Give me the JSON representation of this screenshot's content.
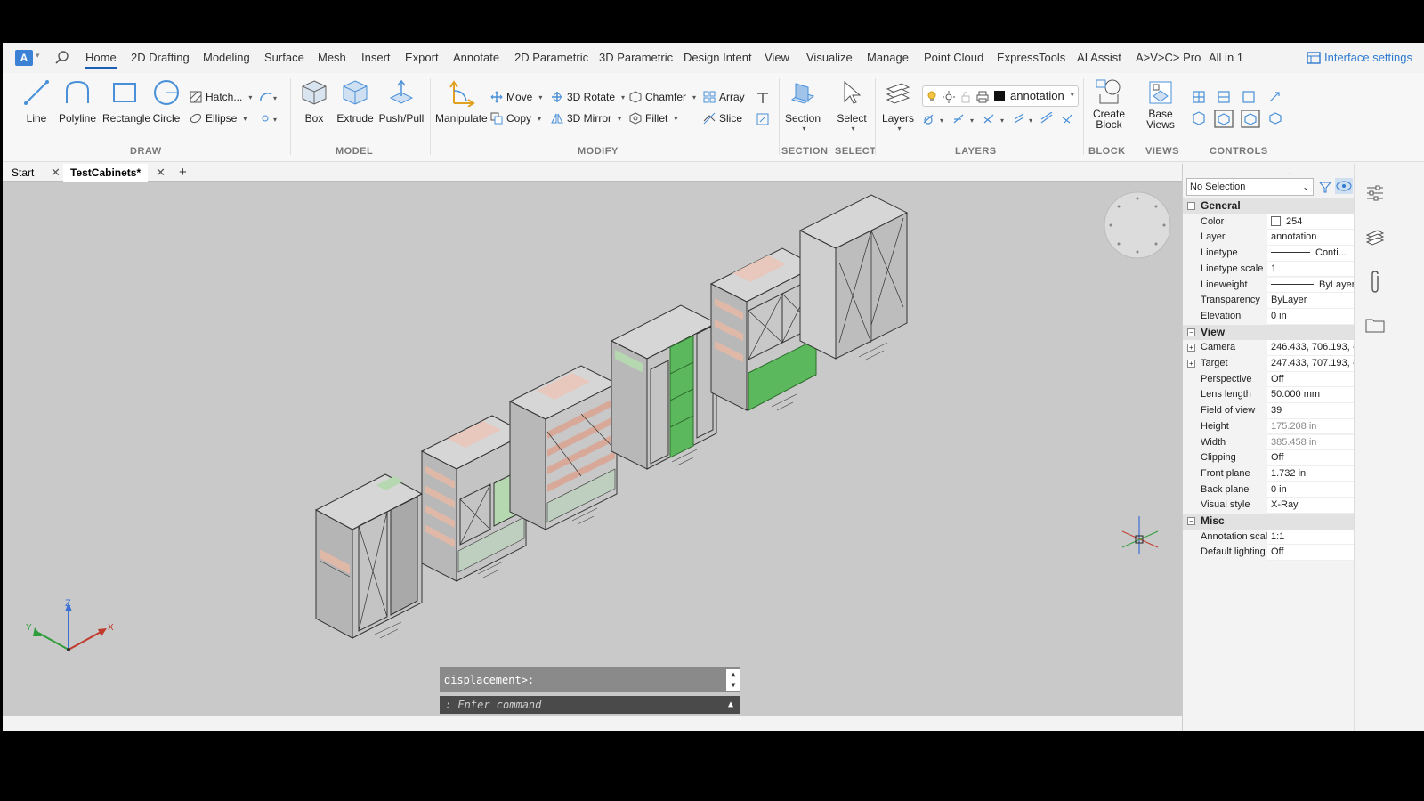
{
  "menu": {
    "tabs": [
      "Home",
      "2D Drafting",
      "Modeling",
      "Surface",
      "Mesh",
      "Insert",
      "Export",
      "Annotate",
      "2D Parametric",
      "3D Parametric",
      "Design Intent",
      "View",
      "Visualize",
      "Manage",
      "Point Cloud",
      "ExpressTools",
      "AI Assist",
      "A>V>C> Pro",
      "All in 1"
    ],
    "active": "Home",
    "interface_settings": "Interface settings"
  },
  "ribbon": {
    "draw": {
      "line": "Line",
      "polyline": "Polyline",
      "rectangle": "Rectangle",
      "circle": "Circle",
      "hatch": "Hatch...",
      "ellipse": "Ellipse",
      "group": "DRAW"
    },
    "model": {
      "box": "Box",
      "extrude": "Extrude",
      "pushpull": "Push/Pull",
      "group": "MODEL"
    },
    "modify": {
      "manipulate": "Manipulate",
      "move": "Move",
      "copy": "Copy",
      "rotate3d": "3D Rotate",
      "mirror3d": "3D Mirror",
      "chamfer": "Chamfer",
      "fillet": "Fillet",
      "array": "Array",
      "slice": "Slice",
      "group": "MODIFY"
    },
    "section": {
      "label": "Section",
      "group": "SECTION"
    },
    "select": {
      "label": "Select",
      "group": "SELECT"
    },
    "layers": {
      "label": "Layers",
      "current": "annotation",
      "group": "LAYERS"
    },
    "block": {
      "create": "Create Block",
      "group": "BLOCK"
    },
    "views": {
      "base": "Base Views",
      "group": "VIEWS"
    },
    "controls": {
      "group": "CONTROLS"
    }
  },
  "doctabs": {
    "start": "Start",
    "current": "TestCabinets*"
  },
  "command": {
    "history": "displacement>:",
    "placeholder": ": Enter command"
  },
  "properties": {
    "selection": "No Selection",
    "general": {
      "title": "General",
      "rows": [
        {
          "k": "Color",
          "v": "254"
        },
        {
          "k": "Layer",
          "v": "annotation"
        },
        {
          "k": "Linetype",
          "v": "Conti..."
        },
        {
          "k": "Linetype scale",
          "v": "1"
        },
        {
          "k": "Lineweight",
          "v": "ByLayer"
        },
        {
          "k": "Transparency",
          "v": "ByLayer"
        },
        {
          "k": "Elevation",
          "v": "0 in"
        }
      ]
    },
    "view": {
      "title": "View",
      "rows": [
        {
          "k": "Camera",
          "v": "246.433, 706.193, -"
        },
        {
          "k": "Target",
          "v": "247.433, 707.193, -"
        },
        {
          "k": "Perspective",
          "v": "Off"
        },
        {
          "k": "Lens length",
          "v": "50.000 mm"
        },
        {
          "k": "Field of view",
          "v": "39"
        },
        {
          "k": "Height",
          "v": "175.208 in"
        },
        {
          "k": "Width",
          "v": "385.458 in"
        },
        {
          "k": "Clipping",
          "v": "Off"
        },
        {
          "k": "Front plane",
          "v": "1.732 in"
        },
        {
          "k": "Back plane",
          "v": "0 in"
        },
        {
          "k": "Visual style",
          "v": "X-Ray"
        }
      ]
    },
    "misc": {
      "title": "Misc",
      "rows": [
        {
          "k": "Annotation scal",
          "v": "1:1"
        },
        {
          "k": "Default lighting",
          "v": "Off"
        }
      ]
    }
  },
  "colors": {
    "accent": "#2f7bd0",
    "viewport": "#c9c9c9",
    "green_panel": "#5cb85c"
  }
}
